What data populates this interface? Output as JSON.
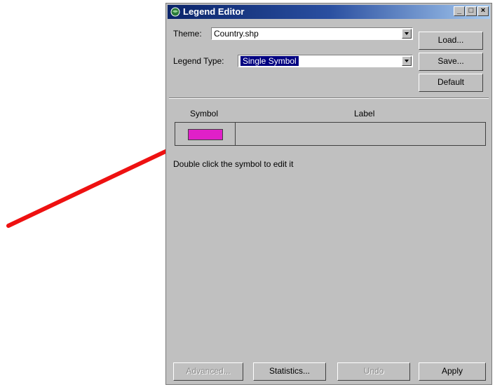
{
  "window": {
    "title": "Legend Editor",
    "controls": {
      "minimize": "_",
      "maximize": "□",
      "close": "×"
    }
  },
  "theme": {
    "label": "Theme:",
    "value": "Country.shp"
  },
  "legend_type": {
    "label": "Legend Type:",
    "value": "Single Symbol"
  },
  "buttons": {
    "load": "Load...",
    "save": "Save...",
    "default": "Default"
  },
  "table": {
    "headers": {
      "symbol": "Symbol",
      "label": "Label"
    },
    "rows": [
      {
        "swatch_color": "#e020c8",
        "label": ""
      }
    ]
  },
  "hint": "Double click the symbol to edit it",
  "footer": {
    "advanced": "Advanced...",
    "statistics": "Statistics...",
    "undo": "Undo",
    "apply": "Apply"
  },
  "annotation_arrow_color": "#ee1111"
}
